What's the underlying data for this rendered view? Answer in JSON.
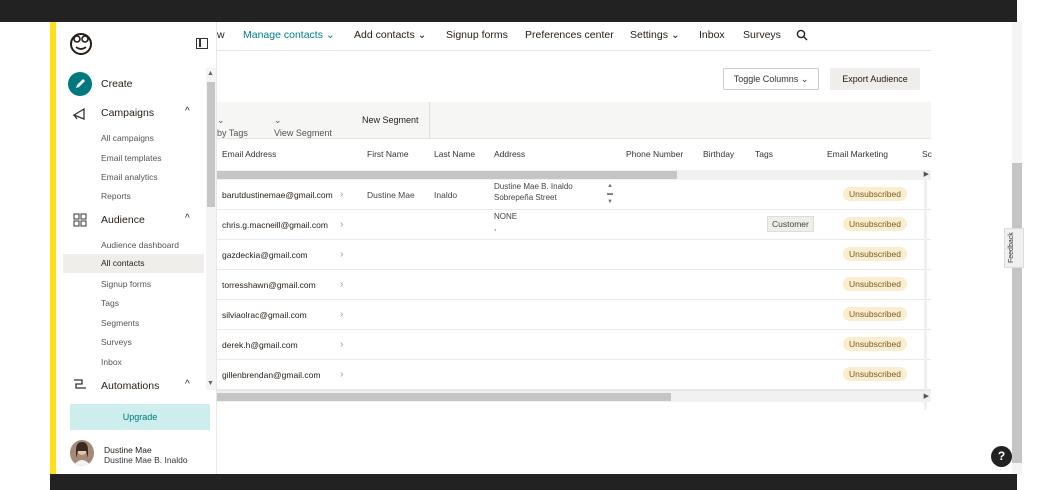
{
  "topnav": {
    "cut_item": "w",
    "items": [
      "Manage contacts",
      "Add contacts",
      "Signup forms",
      "Preferences center",
      "Settings",
      "Inbox",
      "Surveys"
    ],
    "active": "Manage contacts"
  },
  "sidebar": {
    "create": "Create",
    "campaigns": "Campaigns",
    "campaign_items": [
      "All campaigns",
      "Email templates",
      "Email analytics",
      "Reports"
    ],
    "audience": "Audience",
    "audience_items": [
      "Audience dashboard",
      "All contacts",
      "Signup forms",
      "Tags",
      "Segments",
      "Surveys",
      "Inbox"
    ],
    "automations": "Automations",
    "upgrade": "Upgrade",
    "profile_name": "Dustine Mae",
    "profile_full": "Dustine Mae B. Inaldo"
  },
  "toolbar": {
    "toggle_columns": "Toggle Columns",
    "export": "Export Audience"
  },
  "segbar": {
    "tags": "by Tags",
    "view_segment": "View Segment",
    "new_segment": "New Segment"
  },
  "table": {
    "headers": [
      "Email Address",
      "First Name",
      "Last Name",
      "Address",
      "Phone Number",
      "Birthday",
      "Tags",
      "Email Marketing",
      "Sc"
    ],
    "rows": [
      {
        "email": "barutdustinemae@gmail.com",
        "first": "Dustine Mae",
        "last": "Inaldo",
        "addr1": "Dustine Mae B. Inaldo",
        "addr2": "Sobrepeña Street",
        "tag": "",
        "status": "Unsubscribed"
      },
      {
        "email": "chris.g.macneill@gmail.com",
        "first": "",
        "last": "",
        "addr1": "NONE",
        "addr2": ",",
        "tag": "Customer",
        "status": "Unsubscribed"
      },
      {
        "email": "gazdeckia@gmail.com",
        "first": "",
        "last": "",
        "addr1": "",
        "addr2": "",
        "tag": "",
        "status": "Unsubscribed"
      },
      {
        "email": "torresshawn@gmail.com",
        "first": "",
        "last": "",
        "addr1": "",
        "addr2": "",
        "tag": "",
        "status": "Unsubscribed"
      },
      {
        "email": "silviaolrac@gmail.com",
        "first": "",
        "last": "",
        "addr1": "",
        "addr2": "",
        "tag": "",
        "status": "Unsubscribed"
      },
      {
        "email": "derek.h@gmail.com",
        "first": "",
        "last": "",
        "addr1": "",
        "addr2": "",
        "tag": "",
        "status": "Unsubscribed"
      },
      {
        "email": "gillenbrendan@gmail.com",
        "first": "",
        "last": "",
        "addr1": "",
        "addr2": "",
        "tag": "",
        "status": "Unsubscribed"
      }
    ]
  },
  "feedback": "Feedback",
  "help": "?",
  "colors": {
    "accent": "#007c89",
    "yellow": "#ffe01b",
    "badge": "#fbeed0"
  }
}
